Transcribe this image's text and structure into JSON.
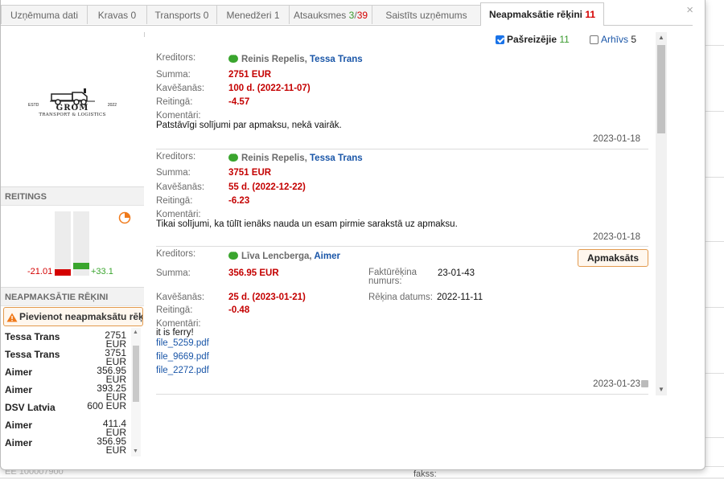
{
  "tabs": [
    {
      "label": "Uzņēmuma dati",
      "count": ""
    },
    {
      "label": "Kravas",
      "count": "0"
    },
    {
      "label": "Transports",
      "count": "0"
    },
    {
      "label": "Menedžeri",
      "count": "1"
    },
    {
      "label": "Atsauksmes",
      "count_green": "3",
      "count_sep": "/",
      "count_red": "39"
    },
    {
      "label": "Saistīts uzņēmums",
      "count": ""
    },
    {
      "label": "Neapmaksātie rēķini",
      "count": "11"
    }
  ],
  "close_label": "×",
  "logo": {
    "brand": "GROM",
    "sub": "TRANSPORT & LOGISTICS",
    "estd": "ESTD",
    "year": "2022"
  },
  "rating": {
    "header": "REITINGS",
    "negative": "-21.01",
    "positive": "+33.1",
    "negative_value": -21.01,
    "positive_value": 33.1
  },
  "unpaid": {
    "header": "NEAPMAKSĀTIE RĒĶINI",
    "add_button": "Pievienot neapmaksātu rēķinu",
    "items": [
      {
        "name": "Tessa Trans",
        "amount": "2751 EUR"
      },
      {
        "name": "Tessa Trans",
        "amount": "3751 EUR"
      },
      {
        "name": "Aimer",
        "amount": "356.95 EUR"
      },
      {
        "name": "Aimer",
        "amount": "393.25 EUR"
      },
      {
        "name": "DSV Latvia",
        "amount": "600 EUR"
      },
      {
        "name": "Aimer",
        "amount": "411.4 EUR"
      },
      {
        "name": "Aimer",
        "amount": "356.95 EUR"
      }
    ]
  },
  "filters": {
    "current_label": "Pašreizējie",
    "current_count": "11",
    "current_checked": true,
    "archive_label": "Arhīvs",
    "archive_count": "5",
    "archive_checked": false
  },
  "labels": {
    "creditor": "Kreditors:",
    "sum": "Summa:",
    "delay": "Kavēšanās:",
    "rating": "Reitingā:",
    "comments": "Komentāri:",
    "invoice_no": "Faktūrēķina numurs:",
    "invoice_date": "Rēķina datums:",
    "paid_button": "Apmaksāts"
  },
  "debts": [
    {
      "person": "Reinis Repelis",
      "company": "Tessa Trans",
      "sum": "2751 EUR",
      "delay": "100 d. (2022-11-07)",
      "rating": "-4.57",
      "comment": "Patstāvīgi solījumi par apmaksu, nekā vairāk.",
      "date": "2023-01-18"
    },
    {
      "person": "Reinis Repelis",
      "company": "Tessa Trans",
      "sum": "3751 EUR",
      "delay": "55 d. (2022-12-22)",
      "rating": "-6.23",
      "comment": "Tikai solījumi, ka tūlīt ienāks nauda un esam pirmie sarakstā uz apmaksu.",
      "date": "2023-01-18"
    },
    {
      "person": "Līva Lencberga",
      "company": "Aimer",
      "sum": "356.95 EUR",
      "delay": "25 d. (2023-01-21)",
      "rating": "-0.48",
      "invoice_no": "23-01-43",
      "invoice_date": "2022-11-11",
      "comment": "it is ferry!",
      "files": [
        "file_5259.pdf",
        "file_9669.pdf",
        "file_2272.pdf"
      ],
      "date": "2023-01-23"
    }
  ],
  "background": {
    "left_text": "EE 100007900",
    "right_text": "fakss:"
  },
  "colors": {
    "accent_red": "#d40000",
    "accent_green": "#3aa52e",
    "link_blue": "#1a56a8",
    "button_orange": "#e29a4e"
  }
}
